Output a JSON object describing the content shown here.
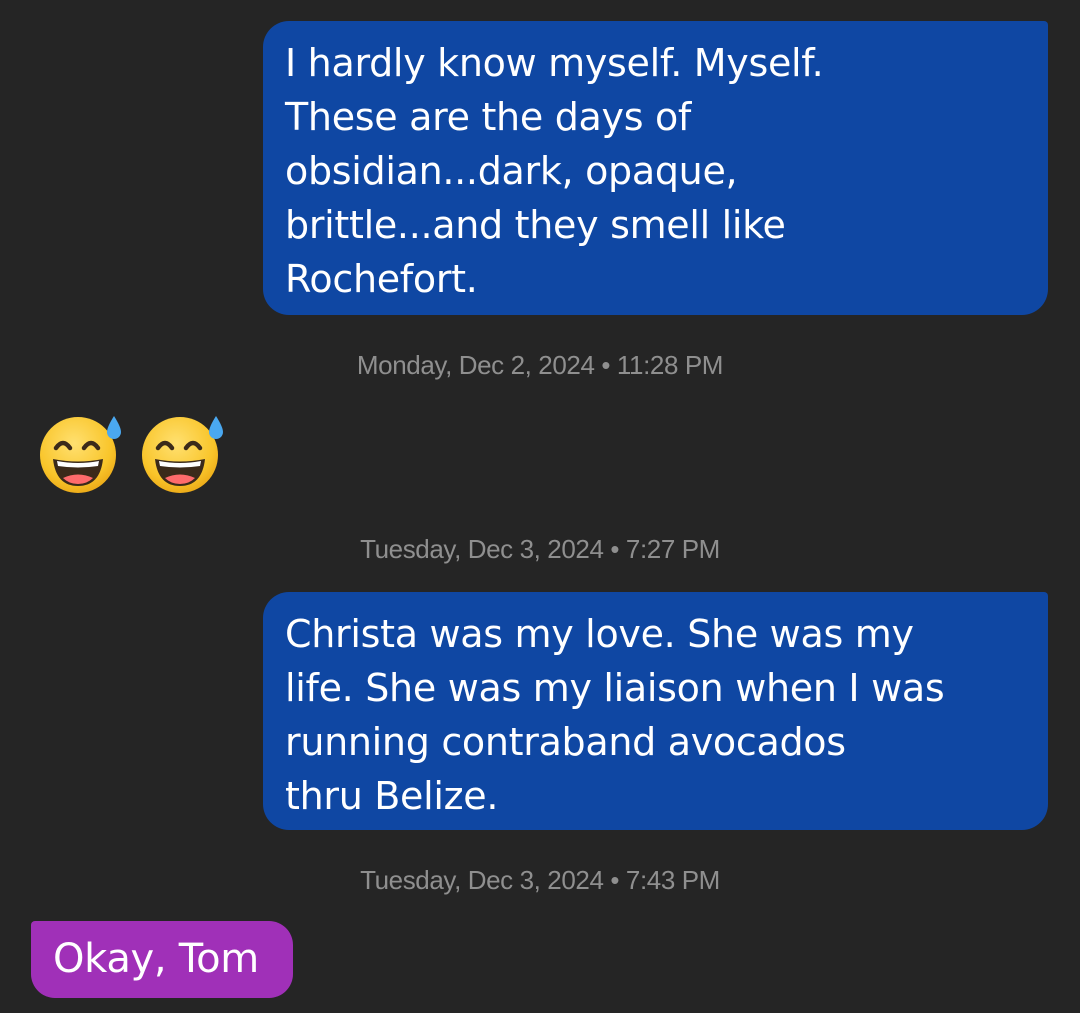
{
  "messages": [
    {
      "direction": "outgoing",
      "lines": [
        "I hardly know myself.  Myself.",
        "These are the days of",
        "obsidian...dark, opaque,",
        "brittle...and they smell like",
        "Rochefort."
      ]
    },
    {
      "direction": "incoming",
      "emojis": [
        "grinning-face-with-sweat-icon",
        "grinning-face-with-sweat-icon"
      ]
    },
    {
      "direction": "outgoing",
      "lines": [
        "Christa was my love.  She was my",
        "life.  She was my liaison when I was",
        "running contraband avocados",
        "thru Belize."
      ]
    },
    {
      "direction": "incoming",
      "text": "Okay, Tom"
    }
  ],
  "timestamps": [
    "Monday, Dec 2, 2024 • 11:28 PM",
    "Tuesday, Dec 3, 2024 • 7:27 PM",
    "Tuesday, Dec 3, 2024 • 7:43 PM"
  ],
  "colors": {
    "background": "#252525",
    "outgoing_bubble": "#0f47a3",
    "incoming_bubble": "#a030b8",
    "timestamp_text": "#8f8f8f",
    "bubble_text": "#ffffff"
  }
}
